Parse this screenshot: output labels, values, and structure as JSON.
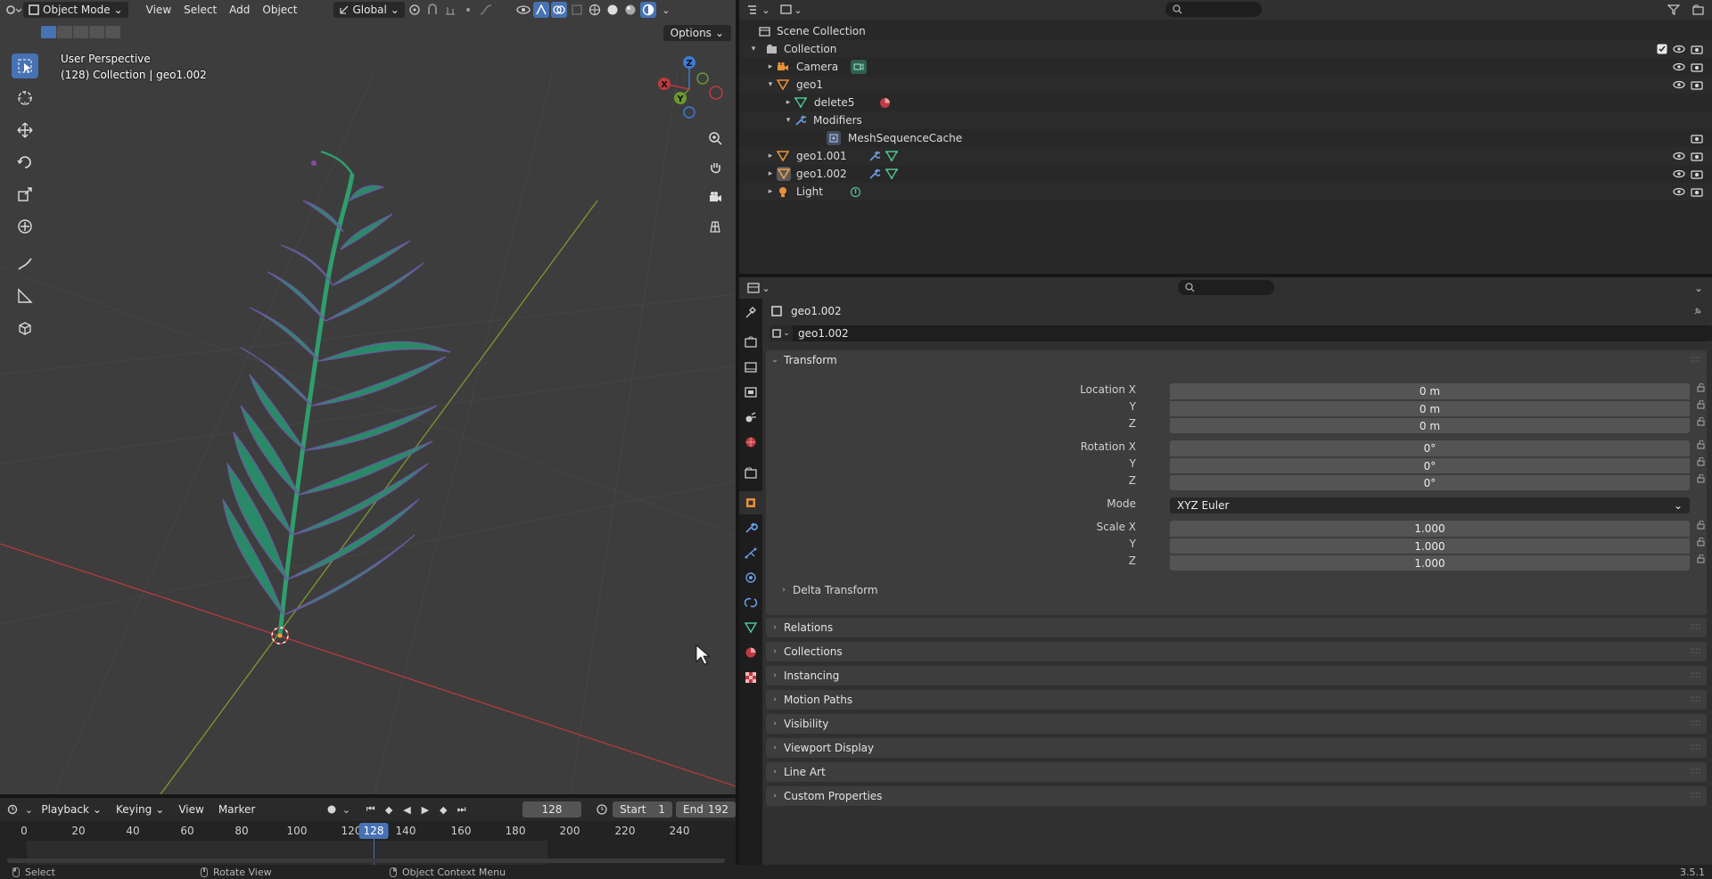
{
  "viewport": {
    "mode_label": "Object Mode",
    "menus": [
      "View",
      "Select",
      "Add",
      "Object"
    ],
    "orientation_label": "Global",
    "options_label": "Options",
    "info_line1": "User Perspective",
    "info_line2": "(128) Collection | geo1.002",
    "gizmo": {
      "x": "X",
      "y": "Y",
      "z": "Z"
    }
  },
  "timeline": {
    "menus": [
      "Playback",
      "Keying",
      "View",
      "Marker"
    ],
    "current_frame": "128",
    "start_label": "Start",
    "start_value": "1",
    "end_label": "End",
    "end_value": "192",
    "ticks": [
      "0",
      "20",
      "40",
      "60",
      "80",
      "100",
      "120",
      "140",
      "160",
      "180",
      "200",
      "220",
      "240"
    ],
    "playhead_label": "128"
  },
  "statusbar": {
    "select": "Select",
    "rotate": "Rotate View",
    "context": "Object Context Menu",
    "version": "3.5.1"
  },
  "outliner": {
    "rows": [
      {
        "label": "Scene Collection"
      },
      {
        "label": "Collection"
      },
      {
        "label": "Camera"
      },
      {
        "label": "geo1"
      },
      {
        "label": "delete5"
      },
      {
        "label": "Modifiers"
      },
      {
        "label": "MeshSequenceCache"
      },
      {
        "label": "geo1.001"
      },
      {
        "label": "geo1.002"
      },
      {
        "label": "Light"
      }
    ]
  },
  "properties": {
    "object_name": "geo1.002",
    "datablock_name": "geo1.002",
    "transform": {
      "title": "Transform",
      "location_label": "Location X",
      "location": [
        "0 m",
        "0 m",
        "0 m"
      ],
      "rotation_label": "Rotation X",
      "rotation": [
        "0°",
        "0°",
        "0°"
      ],
      "mode_label": "Mode",
      "mode_value": "XYZ Euler",
      "scale_label": "Scale X",
      "scale": [
        "1.000",
        "1.000",
        "1.000"
      ],
      "y_label": "Y",
      "z_label": "Z",
      "delta": "Delta Transform"
    },
    "panels": [
      "Relations",
      "Collections",
      "Instancing",
      "Motion Paths",
      "Visibility",
      "Viewport Display",
      "Line Art",
      "Custom Properties"
    ]
  },
  "colors": {
    "accent": "#4772b3",
    "x_axis": "#c0393f",
    "y_axis": "#6b9a2e",
    "z_axis": "#3d7bd6",
    "fern": "#2e9a6c"
  }
}
